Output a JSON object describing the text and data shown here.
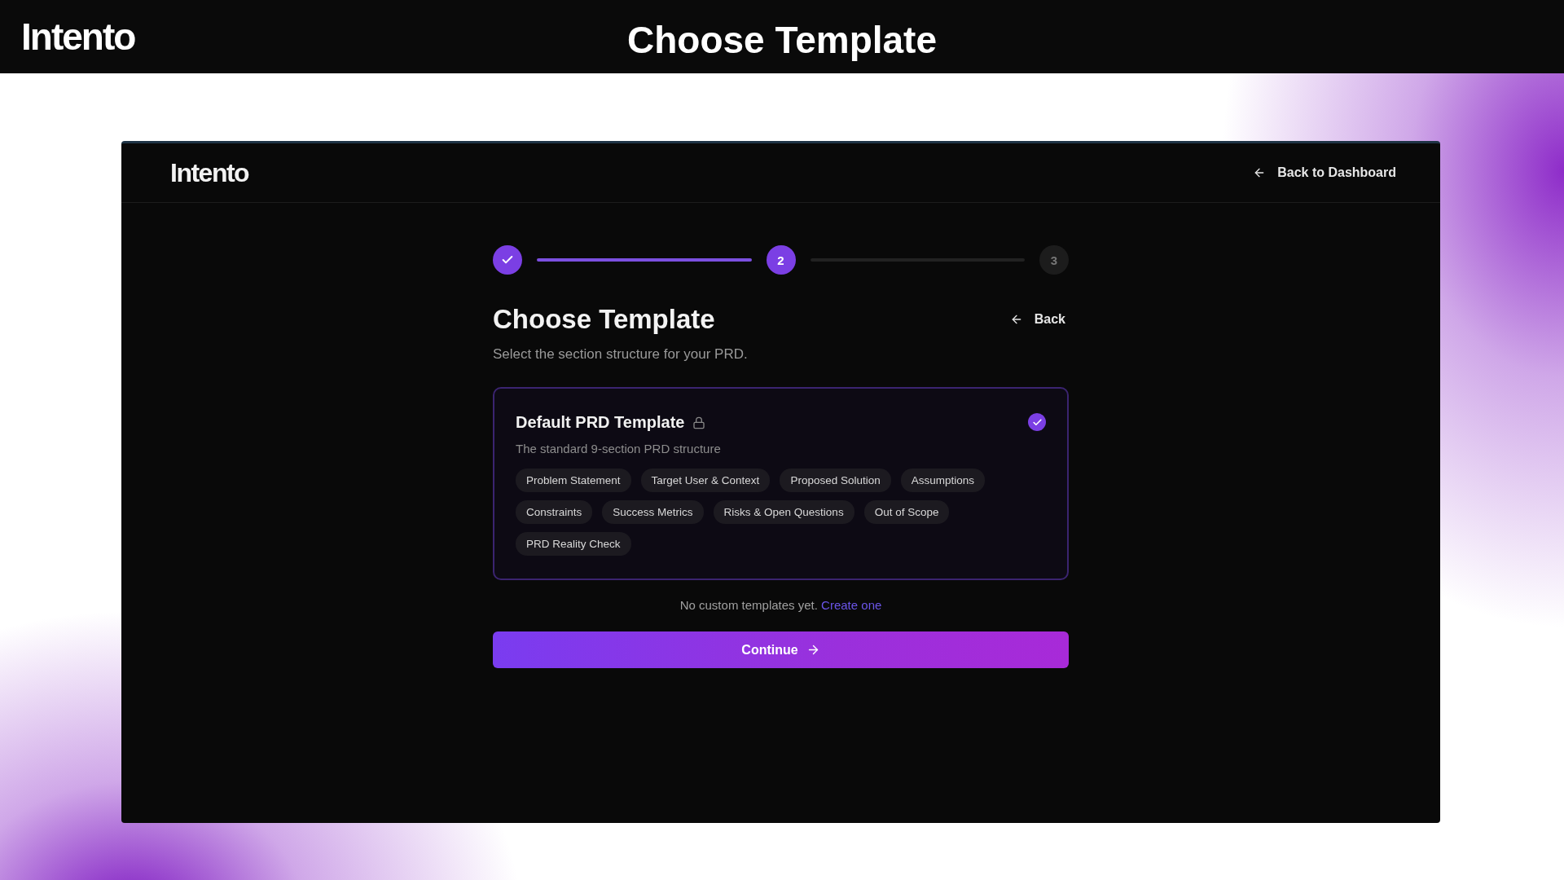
{
  "banner": {
    "logo": "Intento",
    "title": "Choose Template"
  },
  "app": {
    "logo": "Intento",
    "back_to_dashboard": "Back to Dashboard",
    "steps": [
      {
        "completed": true,
        "current": false
      },
      {
        "label": "2",
        "completed": false,
        "current": true
      },
      {
        "label": "3",
        "completed": false,
        "current": false
      }
    ],
    "heading": "Choose Template",
    "back": "Back",
    "subtitle": "Select the section structure for your PRD.",
    "templates": [
      {
        "name": "Default PRD Template",
        "locked": true,
        "selected": true,
        "description": "The standard 9-section PRD structure",
        "sections": [
          "Problem Statement",
          "Target User & Context",
          "Proposed Solution",
          "Assumptions",
          "Constraints",
          "Success Metrics",
          "Risks & Open Questions",
          "Out of Scope",
          "PRD Reality Check"
        ]
      }
    ],
    "empty_note": "No custom templates yet.",
    "create_link": "Create one",
    "continue": "Continue"
  }
}
